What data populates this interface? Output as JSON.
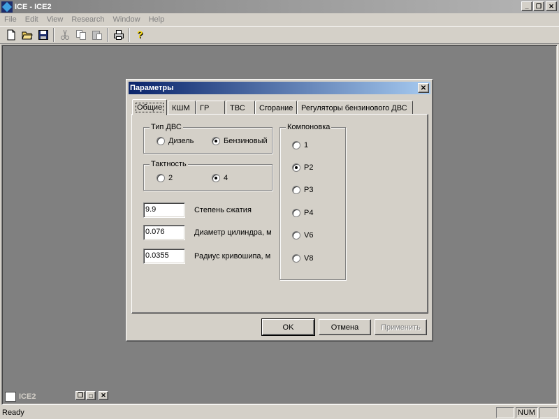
{
  "app": {
    "title": "ICE - ICE2",
    "caption_buttons": [
      "minimize-icon",
      "restore-icon",
      "close-icon"
    ]
  },
  "menu": [
    "File",
    "Edit",
    "View",
    "Research",
    "Window",
    "Help"
  ],
  "toolbar": [
    "new-file-icon",
    "open-folder-icon",
    "save-icon",
    "cut-icon",
    "copy-icon",
    "paste-icon",
    "print-icon",
    "help-icon"
  ],
  "dialog": {
    "title": "Параметры",
    "tabs": [
      {
        "label": "Общие",
        "active": true
      },
      {
        "label": "КШМ",
        "active": false
      },
      {
        "label": "ГР",
        "active": false
      },
      {
        "label": "ТВС",
        "active": false
      },
      {
        "label": "Сгорание",
        "active": false
      },
      {
        "label": "Регуляторы бензинового ДВС",
        "active": false
      }
    ],
    "engine_type": {
      "label": "Тип ДВС",
      "options": [
        {
          "label": "Дизель",
          "checked": false
        },
        {
          "label": "Бензиновый",
          "checked": true
        }
      ]
    },
    "stroke": {
      "label": "Тактность",
      "options": [
        {
          "label": "2",
          "checked": false
        },
        {
          "label": "4",
          "checked": true
        }
      ]
    },
    "fields": [
      {
        "value": "9.9",
        "label": "Степень сжатия"
      },
      {
        "value": "0.076",
        "label": "Диаметр цилиндра, м"
      },
      {
        "value": "0.0355",
        "label": "Радиус кривошипа, м"
      }
    ],
    "layout": {
      "label": "Компоновка",
      "options": [
        {
          "label": "1",
          "checked": false
        },
        {
          "label": "P2",
          "checked": true
        },
        {
          "label": "P3",
          "checked": false
        },
        {
          "label": "P4",
          "checked": false
        },
        {
          "label": "V6",
          "checked": false
        },
        {
          "label": "V8",
          "checked": false
        }
      ]
    },
    "buttons": {
      "ok": "OK",
      "cancel": "Отмена",
      "apply": "Применить"
    }
  },
  "minimized_child": {
    "title": "ICE2"
  },
  "status": {
    "text": "Ready",
    "num": "NUM"
  },
  "colors": {
    "face": "#d4d0c8",
    "mdi_background": "#808080",
    "dialog_title_start": "#0a246a",
    "dialog_title_end": "#a6caf0"
  }
}
